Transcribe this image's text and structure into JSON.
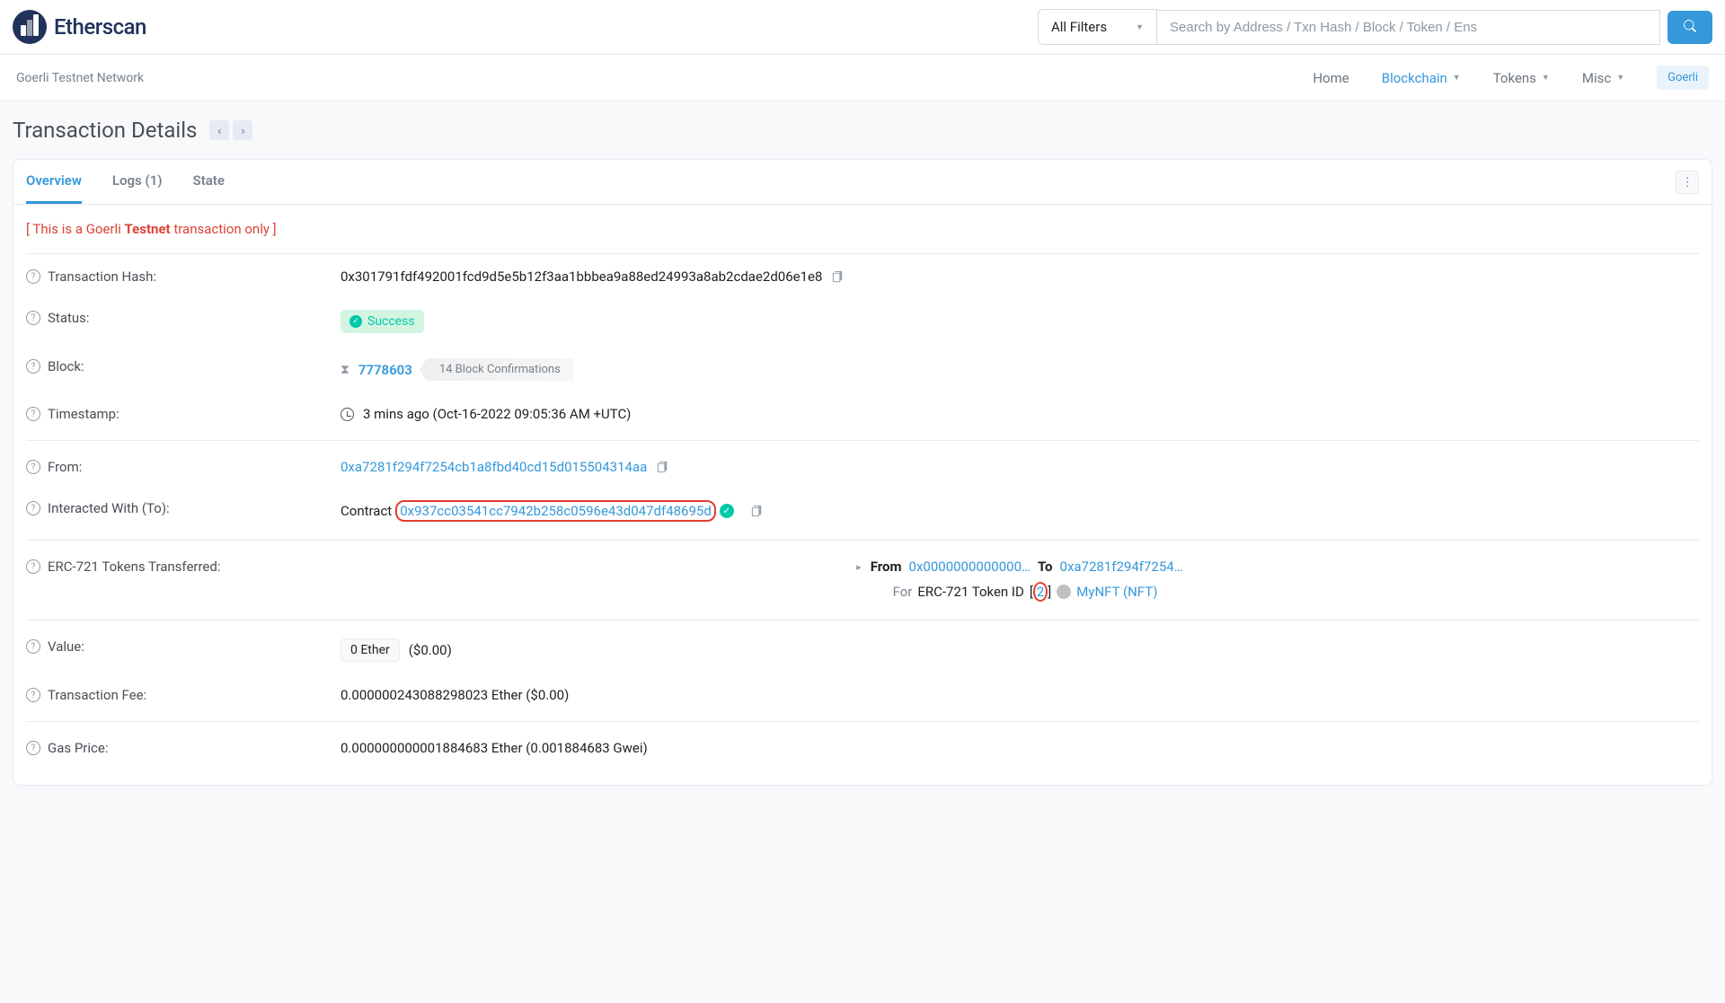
{
  "header": {
    "brand": "Etherscan",
    "filter_label": "All Filters",
    "search_placeholder": "Search by Address / Txn Hash / Block / Token / Ens",
    "network_label": "Goerli Testnet Network",
    "nav": {
      "home": "Home",
      "blockchain": "Blockchain",
      "tokens": "Tokens",
      "misc": "Misc"
    },
    "goerli_badge": "Goerli"
  },
  "page": {
    "title": "Transaction Details",
    "tabs": {
      "overview": "Overview",
      "logs": "Logs (1)",
      "state": "State"
    },
    "notice_prefix": "[ This is a Goerli ",
    "notice_bold": "Testnet",
    "notice_suffix": " transaction only ]"
  },
  "labels": {
    "txhash": "Transaction Hash:",
    "status": "Status:",
    "block": "Block:",
    "timestamp": "Timestamp:",
    "from": "From:",
    "to": "Interacted With (To):",
    "erc721": "ERC-721 Tokens Transferred:",
    "value": "Value:",
    "fee": "Transaction Fee:",
    "gasprice": "Gas Price:"
  },
  "tx": {
    "hash": "0x301791fdf492001fcd9d5e5b12f3aa1bbbea9a88ed24993a8ab2cdae2d06e1e8",
    "status": "Success",
    "block": "7778603",
    "confirmations": "14 Block Confirmations",
    "timestamp": "3 mins ago (Oct-16-2022 09:05:36 AM +UTC)",
    "from": "0xa7281f294f7254cb1a8fbd40cd15d015504314aa",
    "to_prefix": "Contract",
    "to_address": "0x937cc03541cc7942b258c0596e43d047df48695d",
    "transfer": {
      "from_label": "From",
      "from_addr": "0x0000000000000…",
      "to_label": "To",
      "to_addr": "0xa7281f294f7254…",
      "line2_for": "For",
      "line2_token": " ERC-721 Token ID ",
      "token_id": "2",
      "token_name": "MyNFT (NFT)"
    },
    "value_badge": "0 Ether",
    "value_usd": "($0.00)",
    "fee": "0.000000243088298023 Ether ($0.00)",
    "gasprice": "0.000000000001884683 Ether (0.001884683 Gwei)"
  }
}
